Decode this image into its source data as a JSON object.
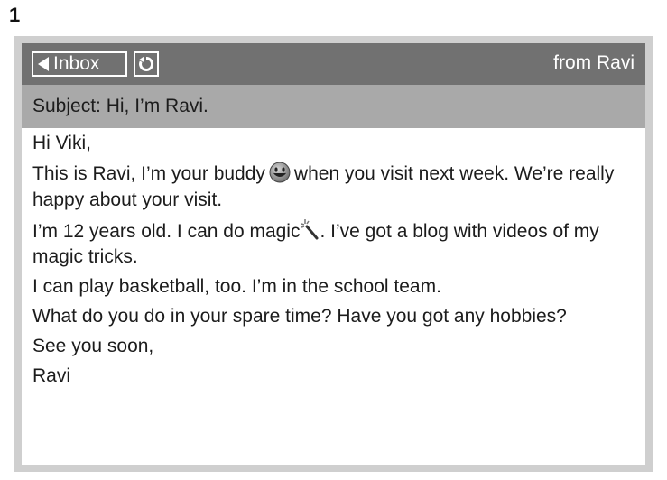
{
  "exercise_number": "1",
  "header": {
    "back_label": "Inbox",
    "from_text": "from Ravi"
  },
  "subject": "Subject: Hi, I’m Ravi.",
  "message": {
    "greeting": "Hi Viki,",
    "p1_before_icon": "This is Ravi, I’m your buddy",
    "p1_after_icon": "when you visit next week. We’re really happy about your visit.",
    "p2_before_icon": "I’m 12 years old. I can do magic",
    "p2_after_icon": ". I’ve got a blog with videos of my magic tricks.",
    "p3": "I can play basketball, too. I’m in the school team.",
    "p4": "What do you do in your spare time? Have you got any hobbies?",
    "closing": "See you soon,",
    "signature": "Ravi"
  },
  "icons": {
    "back": "left-triangle-icon",
    "refresh": "refresh-icon",
    "smiley": "smiley-icon",
    "wand": "magic-wand-icon"
  }
}
